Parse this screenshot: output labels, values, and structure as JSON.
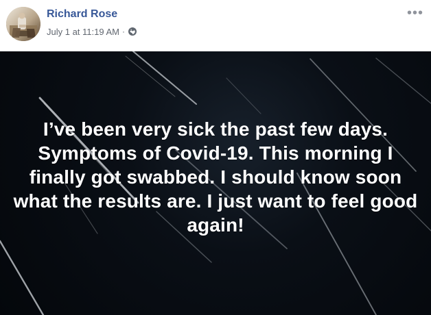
{
  "post": {
    "author": "Richard Rose",
    "timestamp": "July 1 at 11:19 AM",
    "separator": "·",
    "privacy_icon": "globe-icon",
    "more_icon": "more-options-icon",
    "body": "I’ve been very sick the past few days. Symptoms of Covid-19. This morning I finally got swabbed. I should know soon what the results are. I just want to feel good again!"
  },
  "colors": {
    "author_name": "#385898",
    "meta_text": "#616770",
    "image_background": "#0a0f16",
    "post_text": "#ffffff"
  }
}
